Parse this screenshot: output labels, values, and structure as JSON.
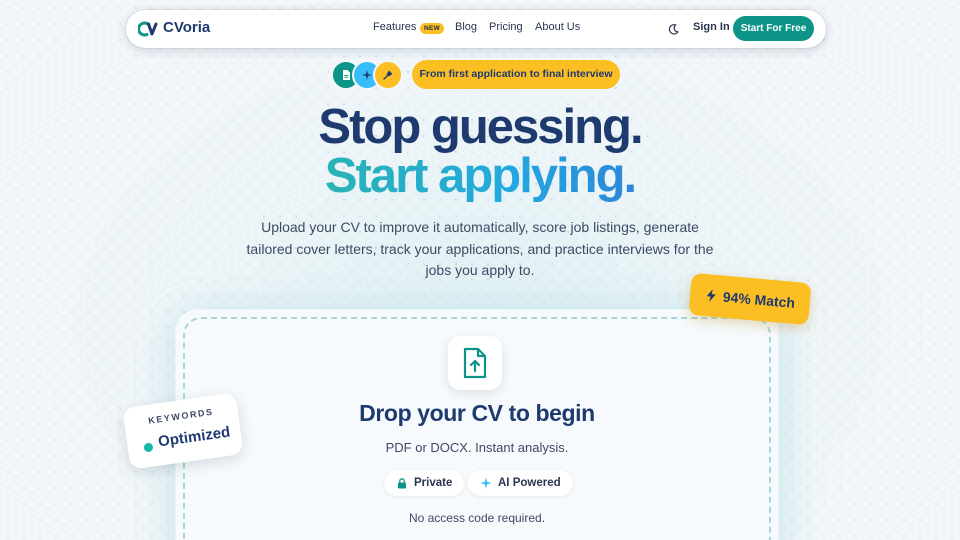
{
  "brand": {
    "name": "CVoria",
    "accent": "#0d9488",
    "navy": "#1e3a6e",
    "yellow": "#fbbf24"
  },
  "nav": {
    "links": [
      {
        "label": "Features"
      },
      {
        "label": "Blog"
      },
      {
        "label": "Pricing"
      },
      {
        "label": "About Us"
      }
    ],
    "new_badge": "NEW",
    "theme_icon": "moon-icon",
    "sign_in": "Sign In",
    "cta": "Start For Free"
  },
  "hero": {
    "badge_icons": [
      "document-icon",
      "sparkle-icon",
      "microphone-icon"
    ],
    "tagline": "From first application to final interview",
    "headline_line1": "Stop guessing.",
    "headline_line2": "Start applying.",
    "subtitle": "Upload your CV to improve it automatically, score job listings, generate tailored cover letters, track your applications, and practice interviews for the jobs you apply to."
  },
  "upload": {
    "icon": "file-upload-icon",
    "title": "Drop your CV to begin",
    "formats": "PDF or DOCX. Instant analysis.",
    "pills": [
      {
        "icon": "lock-icon",
        "label": "Private"
      },
      {
        "icon": "sparkle-icon",
        "label": "AI Powered"
      }
    ],
    "note": "No access code required."
  },
  "floating": {
    "match_icon": "lightning-icon",
    "match_text": "94% Match",
    "keywords_label": "KEYWORDS",
    "keywords_value": "Optimized"
  }
}
